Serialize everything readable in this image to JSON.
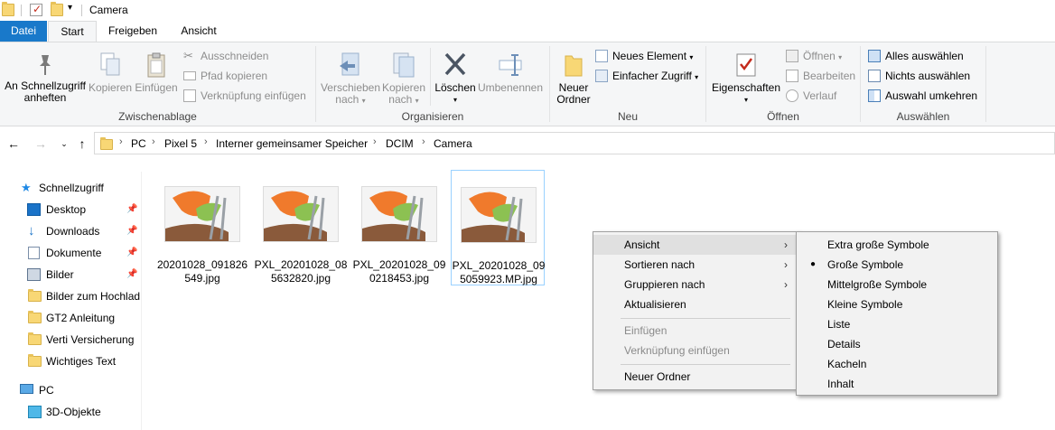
{
  "window": {
    "title": "Camera"
  },
  "tabs": {
    "datei": "Datei",
    "start": "Start",
    "freigeben": "Freigeben",
    "ansicht": "Ansicht"
  },
  "ribbon": {
    "clipboard": {
      "pin_line1": "An Schnellzugriff",
      "pin_line2": "anheften",
      "copy": "Kopieren",
      "paste": "Einfügen",
      "cut": "Ausschneiden",
      "copy_path": "Pfad kopieren",
      "paste_shortcut": "Verknüpfung einfügen",
      "label": "Zwischenablage"
    },
    "organize": {
      "move_line1": "Verschieben",
      "move_line2": "nach",
      "copyto_line1": "Kopieren",
      "copyto_line2": "nach",
      "delete": "Löschen",
      "rename": "Umbenennen",
      "label": "Organisieren"
    },
    "new": {
      "folder_line1": "Neuer",
      "folder_line2": "Ordner",
      "new_item": "Neues Element",
      "easy_access": "Einfacher Zugriff",
      "label": "Neu"
    },
    "open": {
      "properties": "Eigenschaften",
      "open": "Öffnen",
      "edit": "Bearbeiten",
      "history": "Verlauf",
      "label": "Öffnen"
    },
    "select": {
      "select_all": "Alles auswählen",
      "select_none": "Nichts auswählen",
      "invert": "Auswahl umkehren",
      "label": "Auswählen"
    }
  },
  "address": {
    "crumbs": [
      "PC",
      "Pixel 5",
      "Interner gemeinsamer Speicher",
      "DCIM",
      "Camera"
    ]
  },
  "nav": {
    "quick_access": "Schnellzugriff",
    "items": [
      "Desktop",
      "Downloads",
      "Dokumente",
      "Bilder",
      "Bilder zum Hochlad",
      "GT2 Anleitung",
      "Verti Versicherung",
      "Wichtiges Text"
    ],
    "pc": "PC",
    "objects3d": "3D-Objekte"
  },
  "files": [
    {
      "line1": "20201028_091826",
      "line2": "549.jpg"
    },
    {
      "line1": "PXL_20201028_08",
      "line2": "5632820.jpg"
    },
    {
      "line1": "PXL_20201028_09",
      "line2": "0218453.jpg"
    },
    {
      "line1": "PXL_20201028_09",
      "line2": "5059923.MP.jpg"
    }
  ],
  "context_menu": {
    "view": "Ansicht",
    "sort": "Sortieren nach",
    "group": "Gruppieren nach",
    "refresh": "Aktualisieren",
    "paste": "Einfügen",
    "paste_shortcut": "Verknüpfung einfügen",
    "new_folder": "Neuer Ordner"
  },
  "view_submenu": {
    "items": [
      "Extra große Symbole",
      "Große Symbole",
      "Mittelgroße Symbole",
      "Kleine Symbole",
      "Liste",
      "Details",
      "Kacheln",
      "Inhalt"
    ],
    "selected": "Große Symbole"
  },
  "colors": {
    "accent": "#1979ca",
    "selection_border": "#99d1ff",
    "folder": "#f8d775"
  }
}
